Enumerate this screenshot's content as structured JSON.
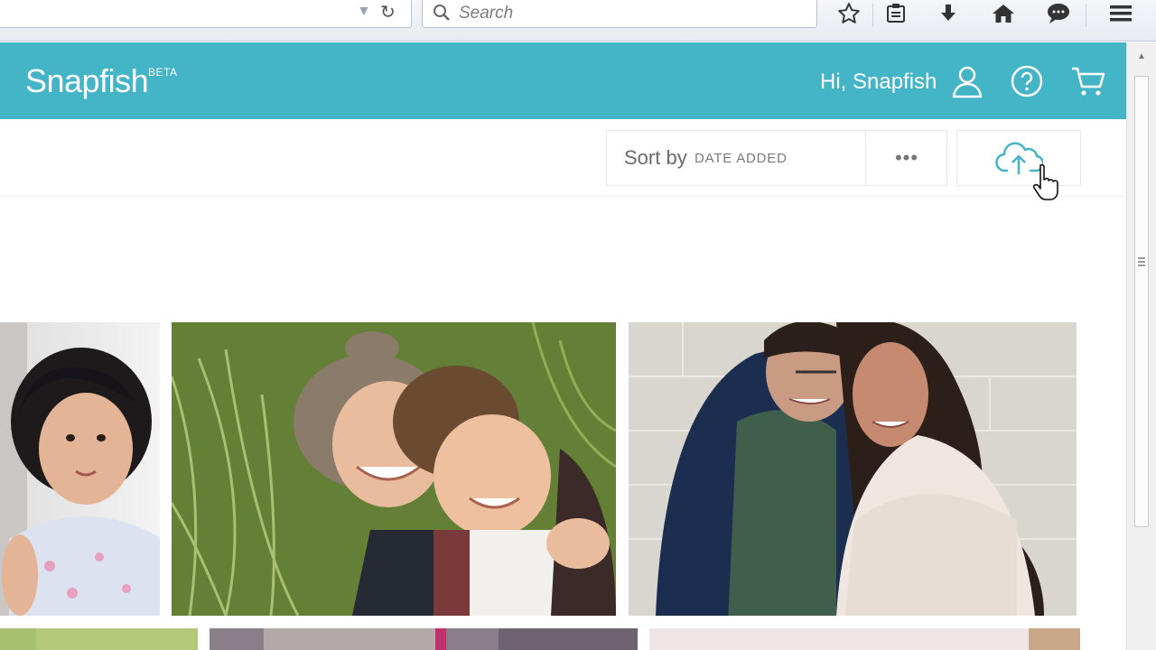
{
  "browser": {
    "search": {
      "placeholder": "Search"
    },
    "toolbar_icons": [
      "bookmark-star-icon",
      "reading-list-icon",
      "downloads-icon",
      "home-icon",
      "chat-icon",
      "menu-icon"
    ]
  },
  "app": {
    "logo": "Snapfish",
    "logo_badge": "BETA",
    "greeting": "Hi, Snapfish",
    "header_color": "#43b5c7",
    "header_icons": [
      "user-icon",
      "help-icon",
      "cart-icon"
    ]
  },
  "toolbar": {
    "sort_label": "Sort by",
    "sort_value": "DATE ADDED",
    "more_label": "•••",
    "upload_icon": "cloud-upload-icon"
  },
  "photos": [
    {
      "subject": "toddler"
    },
    {
      "subject": "laughing-kids"
    },
    {
      "subject": "couple"
    },
    {
      "subject": "photo-row2-1"
    },
    {
      "subject": "photo-row2-2"
    },
    {
      "subject": "photo-row2-3"
    }
  ]
}
